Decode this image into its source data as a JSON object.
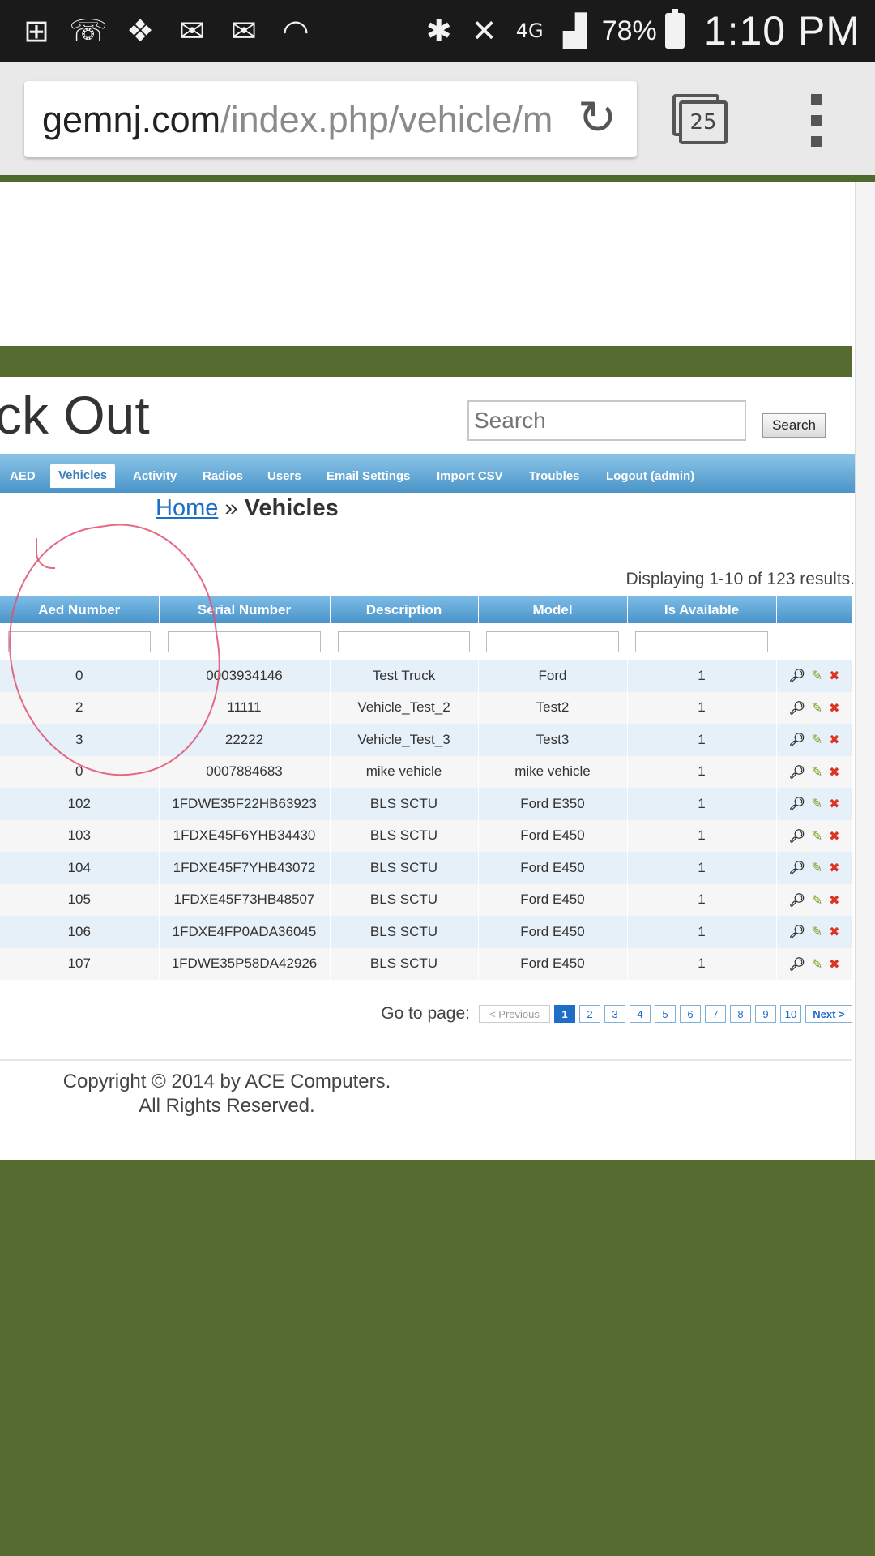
{
  "status_bar": {
    "icons": [
      "add-box-icon",
      "missed-call-icon",
      "dropbox-icon",
      "email-app-icon",
      "gmail-icon",
      "swipe-icon",
      "bluetooth-icon",
      "mute-icon",
      "4g-lte-icon",
      "signal-icon"
    ],
    "battery": "78%",
    "time": "1:10 PM"
  },
  "browser": {
    "url_domain": "gemnj.com",
    "url_path": "/index.php/vehicle/m",
    "tab_count": "25"
  },
  "site": {
    "title": "ck Out",
    "search_placeholder": "Search",
    "search_button": "Search"
  },
  "nav": {
    "items": [
      "AED",
      "Vehicles",
      "Activity",
      "Radios",
      "Users",
      "Email Settings",
      "Import CSV",
      "Troubles",
      "Logout (admin)"
    ],
    "active": "Vehicles"
  },
  "breadcrumb": {
    "home": "Home",
    "separator": "»",
    "current": "Vehicles"
  },
  "summary": "Displaying 1-10 of 123 results.",
  "table": {
    "columns": [
      "Aed Number",
      "Serial Number",
      "Description",
      "Model",
      "Is Available"
    ],
    "rows": [
      [
        "0",
        "0003934146",
        "Test Truck",
        "Ford",
        "1"
      ],
      [
        "2",
        "11111",
        "Vehicle_Test_2",
        "Test2",
        "1"
      ],
      [
        "3",
        "22222",
        "Vehicle_Test_3",
        "Test3",
        "1"
      ],
      [
        "0",
        "0007884683",
        "mike vehicle",
        "mike vehicle",
        "1"
      ],
      [
        "102",
        "1FDWE35F22HB63923",
        "BLS SCTU",
        "Ford E350",
        "1"
      ],
      [
        "103",
        "1FDXE45F6YHB34430",
        "BLS SCTU",
        "Ford E450",
        "1"
      ],
      [
        "104",
        "1FDXE45F7YHB43072",
        "BLS SCTU",
        "Ford E450",
        "1"
      ],
      [
        "105",
        "1FDXE45F73HB48507",
        "BLS SCTU",
        "Ford E450",
        "1"
      ],
      [
        "106",
        "1FDXE4FP0ADA36045",
        "BLS SCTU",
        "Ford E450",
        "1"
      ],
      [
        "107",
        "1FDWE35P58DA42926",
        "BLS SCTU",
        "Ford E450",
        "1"
      ]
    ]
  },
  "pager": {
    "label": "Go to page:",
    "prev": "< Previous",
    "pages": [
      "1",
      "2",
      "3",
      "4",
      "5",
      "6",
      "7",
      "8",
      "9",
      "10"
    ],
    "current": "1",
    "next": "Next >"
  },
  "footer": {
    "line1": "Copyright © 2014 by ACE Computers.",
    "line2": "All Rights Reserved."
  },
  "colors": {
    "olive": "#566b2f",
    "nav_blue": "#4a95c8",
    "link_blue": "#1e6ec8",
    "row_blue": "#e6f0f8",
    "annotation": "#e05070"
  }
}
